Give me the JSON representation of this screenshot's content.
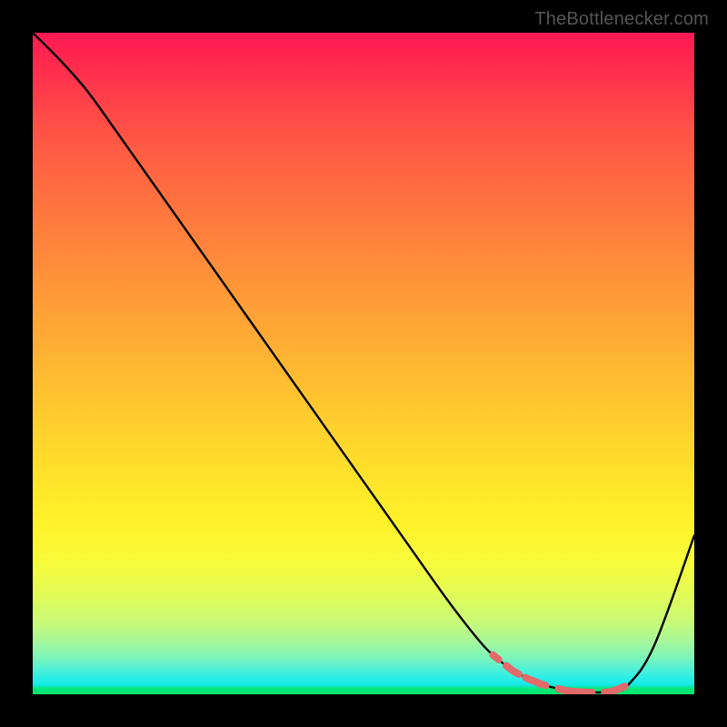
{
  "watermark": "TheBottlenecker.com",
  "chart_data": {
    "type": "line",
    "title": "",
    "xlabel": "",
    "ylabel": "",
    "xlim": [
      0,
      100
    ],
    "ylim": [
      0,
      100
    ],
    "grid": false,
    "x": [
      0,
      4,
      8,
      12,
      18,
      24,
      30,
      36,
      42,
      48,
      54,
      60,
      64,
      68,
      70,
      72,
      74,
      76,
      78,
      80,
      82,
      84,
      86,
      88,
      90,
      94,
      100
    ],
    "values": [
      100,
      96,
      91.5,
      86,
      77.5,
      69,
      60.5,
      52,
      43.5,
      35,
      26.5,
      18,
      12.5,
      7.5,
      5.6,
      4.0,
      2.8,
      1.9,
      1.2,
      0.7,
      0.4,
      0.3,
      0.3,
      0.45,
      1.4,
      7.5,
      24
    ],
    "markers": {
      "x": [
        70,
        72,
        73,
        75,
        76,
        77,
        80,
        81,
        82,
        83,
        84,
        87,
        88,
        89
      ],
      "y": [
        5.6,
        4.0,
        3.3,
        2.3,
        1.9,
        1.5,
        0.7,
        0.5,
        0.4,
        0.35,
        0.3,
        0.35,
        0.6,
        1.0
      ],
      "style": "red-dash"
    },
    "background": "rainbow-vertical",
    "line_color": "#000000"
  }
}
